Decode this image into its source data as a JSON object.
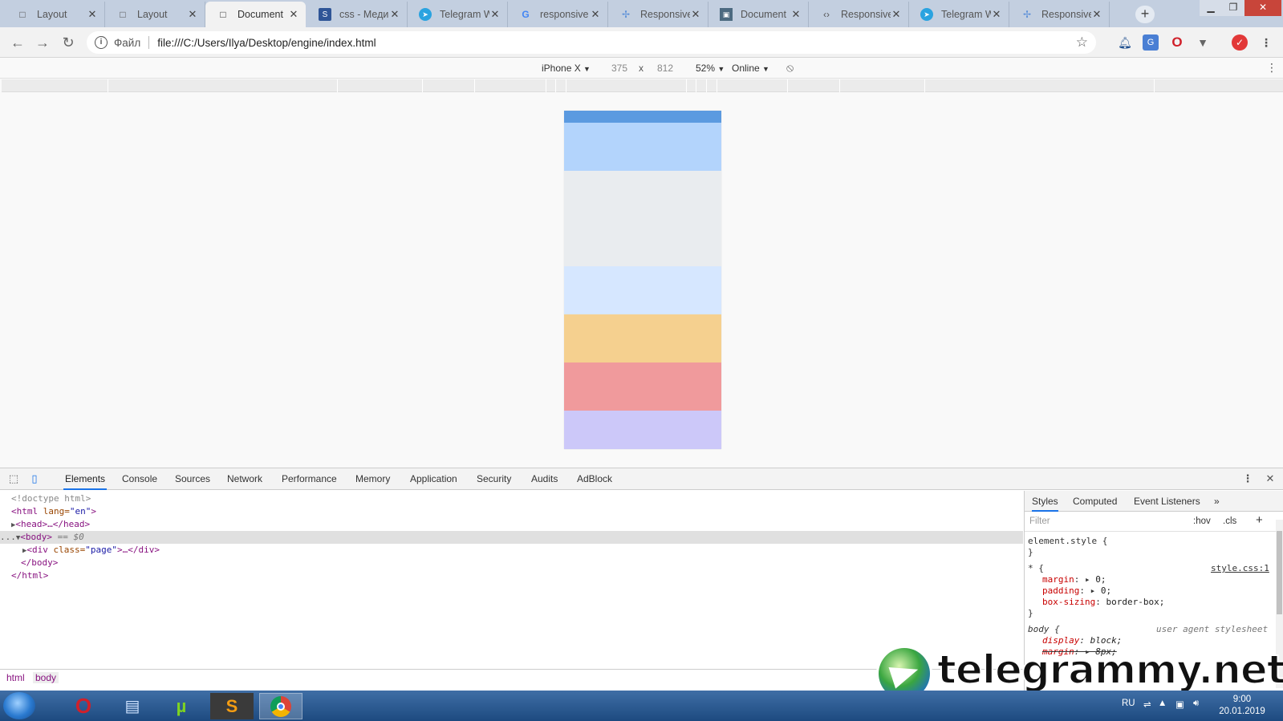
{
  "browser": {
    "tabs": [
      {
        "title": "Layout",
        "icon": "page-icon"
      },
      {
        "title": "Layout",
        "icon": "page-icon"
      },
      {
        "title": "Document",
        "icon": "page-icon",
        "active": true
      },
      {
        "title": "css - Медиа",
        "icon": "stackoverflow-icon"
      },
      {
        "title": "Telegram W",
        "icon": "telegram-icon"
      },
      {
        "title": "responsive",
        "icon": "google-icon"
      },
      {
        "title": "Responsive",
        "icon": "responsive-icon"
      },
      {
        "title": "Document",
        "icon": "document-icon"
      },
      {
        "title": "Responsive",
        "icon": "responsive-icon"
      },
      {
        "title": "Telegram W",
        "icon": "telegram-icon"
      },
      {
        "title": "Responsive",
        "icon": "responsive-icon"
      }
    ],
    "address": {
      "scheme_label": "Файл",
      "url": "file:///C:/Users/Ilya/Desktop/engine/index.html"
    }
  },
  "device_toolbar": {
    "device": "iPhone X",
    "width": "375",
    "times": "x",
    "height": "812",
    "zoom": "52%",
    "network": "Online"
  },
  "preview": {
    "blocks": [
      {
        "color": "#5b9ae0"
      },
      {
        "color": "#b3d4fc"
      },
      {
        "color": "#e9ecef"
      },
      {
        "color": "#d6e7ff"
      },
      {
        "color": "#f5d08f"
      },
      {
        "color": "#f09a9c"
      },
      {
        "color": "#ccc8f9"
      }
    ]
  },
  "devtools": {
    "tabs": [
      "Elements",
      "Console",
      "Sources",
      "Network",
      "Performance",
      "Memory",
      "Application",
      "Security",
      "Audits",
      "AdBlock"
    ],
    "dom": {
      "doctype": "<!doctype html>",
      "html_open_tag": "<html",
      "html_attr": " lang=",
      "html_attr_val": "\"en\"",
      "html_open_end": ">",
      "head": "<head>…</head>",
      "body_open": "<body>",
      "body_eq": " == $0",
      "div_open": "<div",
      "div_attr": " class=",
      "div_attr_val": "\"page\"",
      "div_rest": ">…</div>",
      "body_close": "</body>",
      "html_close": "</html>",
      "ellipsis": "..."
    },
    "breadcrumbs": [
      "html",
      "body"
    ],
    "styles": {
      "tabs": [
        "Styles",
        "Computed",
        "Event Listeners"
      ],
      "filter_placeholder": "Filter",
      "hov": ":hov",
      "cls": ".cls",
      "element_style": "element.style {",
      "close_brace": "}",
      "universal_selector": "* {",
      "universal_source": "style.css:1",
      "rules_universal": [
        {
          "prop": "margin",
          "value": "0;"
        },
        {
          "prop": "padding",
          "value": "0;"
        },
        {
          "prop": "box-sizing",
          "value": "border-box;"
        }
      ],
      "body_selector": "body {",
      "body_source": "user agent stylesheet",
      "rules_body": [
        {
          "prop": "display",
          "value": "block;"
        },
        {
          "prop": "margin",
          "value": "8px;"
        }
      ]
    }
  },
  "taskbar": {
    "language": "RU",
    "time": "9:00",
    "date": "20.01.2019"
  },
  "watermark": {
    "text": "telegrammy.net"
  }
}
